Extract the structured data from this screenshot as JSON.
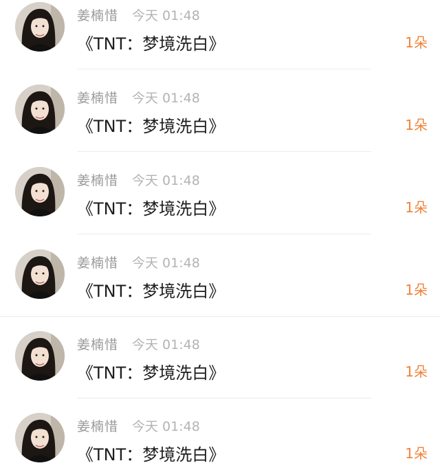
{
  "messages": [
    {
      "sender": "姜楠惜",
      "time": "今天 01:48",
      "text": "《TNT：梦境洗白》",
      "count": "1朵",
      "avatar": "woman-portrait-avatar"
    },
    {
      "sender": "姜楠惜",
      "time": "今天 01:48",
      "text": "《TNT：梦境洗白》",
      "count": "1朵",
      "avatar": "woman-portrait-avatar"
    },
    {
      "sender": "姜楠惜",
      "time": "今天 01:48",
      "text": "《TNT：梦境洗白》",
      "count": "1朵",
      "avatar": "woman-portrait-avatar"
    },
    {
      "sender": "姜楠惜",
      "time": "今天 01:48",
      "text": "《TNT：梦境洗白》",
      "count": "1朵",
      "avatar": "woman-portrait-avatar"
    },
    {
      "sender": "姜楠惜",
      "time": "今天 01:48",
      "text": "《TNT：梦境洗白》",
      "count": "1朵",
      "avatar": "woman-portrait-avatar"
    },
    {
      "sender": "姜楠惜",
      "time": "今天 01:48",
      "text": "《TNT：梦境洗白》",
      "count": "1朵",
      "avatar": "woman-portrait-avatar"
    }
  ],
  "colors": {
    "count_accent": "#f0823a",
    "sender_gray": "#9a9a9a",
    "time_gray": "#b3b3b3",
    "text_dark": "#1e1e1e"
  }
}
